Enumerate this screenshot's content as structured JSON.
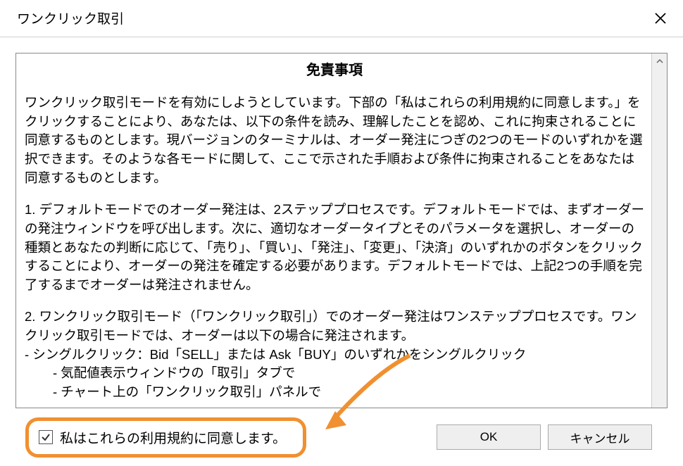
{
  "title": "ワンクリック取引",
  "disclaimer": {
    "heading": "免責事項",
    "p1": "ワンクリック取引モードを有効にしようとしています。下部の「私はこれらの利用規約に同意します。」をクリックすることにより、あなたは、以下の条件を読み、理解したことを認め、これに拘束されることに同意するものとします。現バージョンのターミナルは、オーダー発注につぎの2つのモードのいずれかを選択できます。そのような各モードに関して、ここで示された手順および条件に拘束されることをあなたは同意するものとします。",
    "p2": "1. デフォルトモードでのオーダー発注は、2ステッププロセスです。デフォルトモードでは、まずオーダーの発注ウィンドウを呼び出します。次に、適切なオーダータイプとそのパラメータを選択し、オーダーの種類とあなたの判断に応じて、「売り」、「買い」、「発注」、「変更」、「決済」のいずれかのボタンをクリックすることにより、オーダーの発注を確定する必要があります。デフォルトモードでは、上記2つの手順を完了するまでオーダーは発注されません。",
    "p3a": "2. ワンクリック取引モード（「ワンクリック取引」）でのオーダー発注はワンステッププロセスです。ワンクリック取引モードでは、オーダーは以下の場合に発注されます。",
    "p3b": "- シングルクリック：Bid「SELL」または Ask「BUY」のいずれかをシングルクリック",
    "p3c": "- 気配値表示ウィンドウの「取引」タブで",
    "p3d": "- チャート上の「ワンクリック取引」パネルで"
  },
  "agree_label": "私はこれらの利用規約に同意します。",
  "buttons": {
    "ok": "OK",
    "cancel": "キャンセル"
  }
}
